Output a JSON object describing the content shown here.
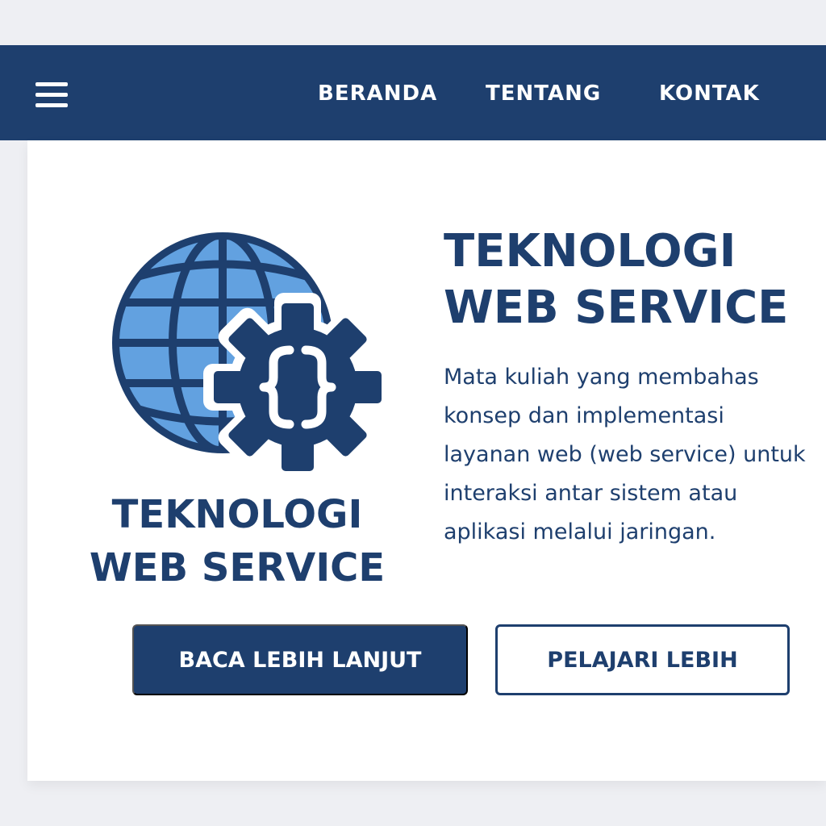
{
  "nav": {
    "menu_icon": "hamburger-menu-icon",
    "links": [
      "BERANDA",
      "TENTANG",
      "KONTAK"
    ]
  },
  "logo": {
    "icon": "globe-gear-code-icon",
    "line1": "TEKNOLOGI",
    "line2": "WEB SERVICE"
  },
  "hero": {
    "title_line1": "TEKNOLOGI",
    "title_line2": "WEB SERVICE",
    "description": "Mata kuliah yang membahas konsep dan implementasi layanan web (web service) untuk interaksi antar sistem atau aplikasi melalui jaringan."
  },
  "buttons": {
    "primary_label": "BACA LEBIH LANJUT",
    "secondary_label": "PELAJARI LEBIH"
  },
  "colors": {
    "brand": "#1e3f6e",
    "globe_fill": "#62a1e0",
    "page_background": "#eeeff3",
    "card_background": "#ffffff"
  }
}
